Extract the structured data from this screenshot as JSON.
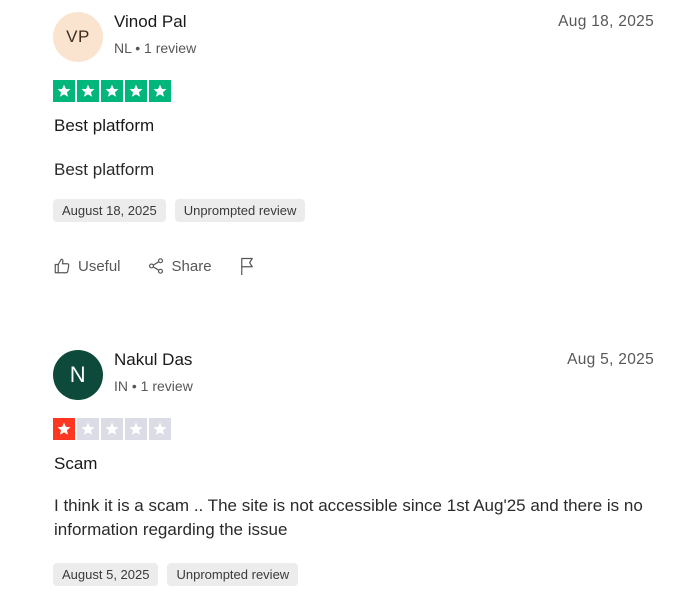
{
  "reviews": [
    {
      "initials": "VP",
      "name": "Vinod Pal",
      "meta": "NL • 1 review",
      "date": "Aug 18, 2025",
      "rating": 5,
      "rating_color": "#00b67a",
      "empty_star_color": "#dcdce6",
      "title": "Best platform",
      "body": "Best platform",
      "tags": [
        "August 18, 2025",
        "Unprompted review"
      ],
      "actions": {
        "useful": "Useful",
        "share": "Share"
      }
    },
    {
      "initials": "N",
      "name": "Nakul Das",
      "meta": "IN • 1 review",
      "date": "Aug 5, 2025",
      "rating": 1,
      "rating_color": "#ff3722",
      "empty_star_color": "#dcdce6",
      "title": "Scam",
      "body": "I think it is a scam .. The site is not accessible since 1st Aug'25 and there is no information regarding the issue",
      "tags": [
        "August 5, 2025",
        "Unprompted review"
      ]
    }
  ],
  "icons": {
    "useful": "thumbs-up-icon",
    "share": "share-icon",
    "flag": "flag-icon",
    "star": "star-icon"
  }
}
